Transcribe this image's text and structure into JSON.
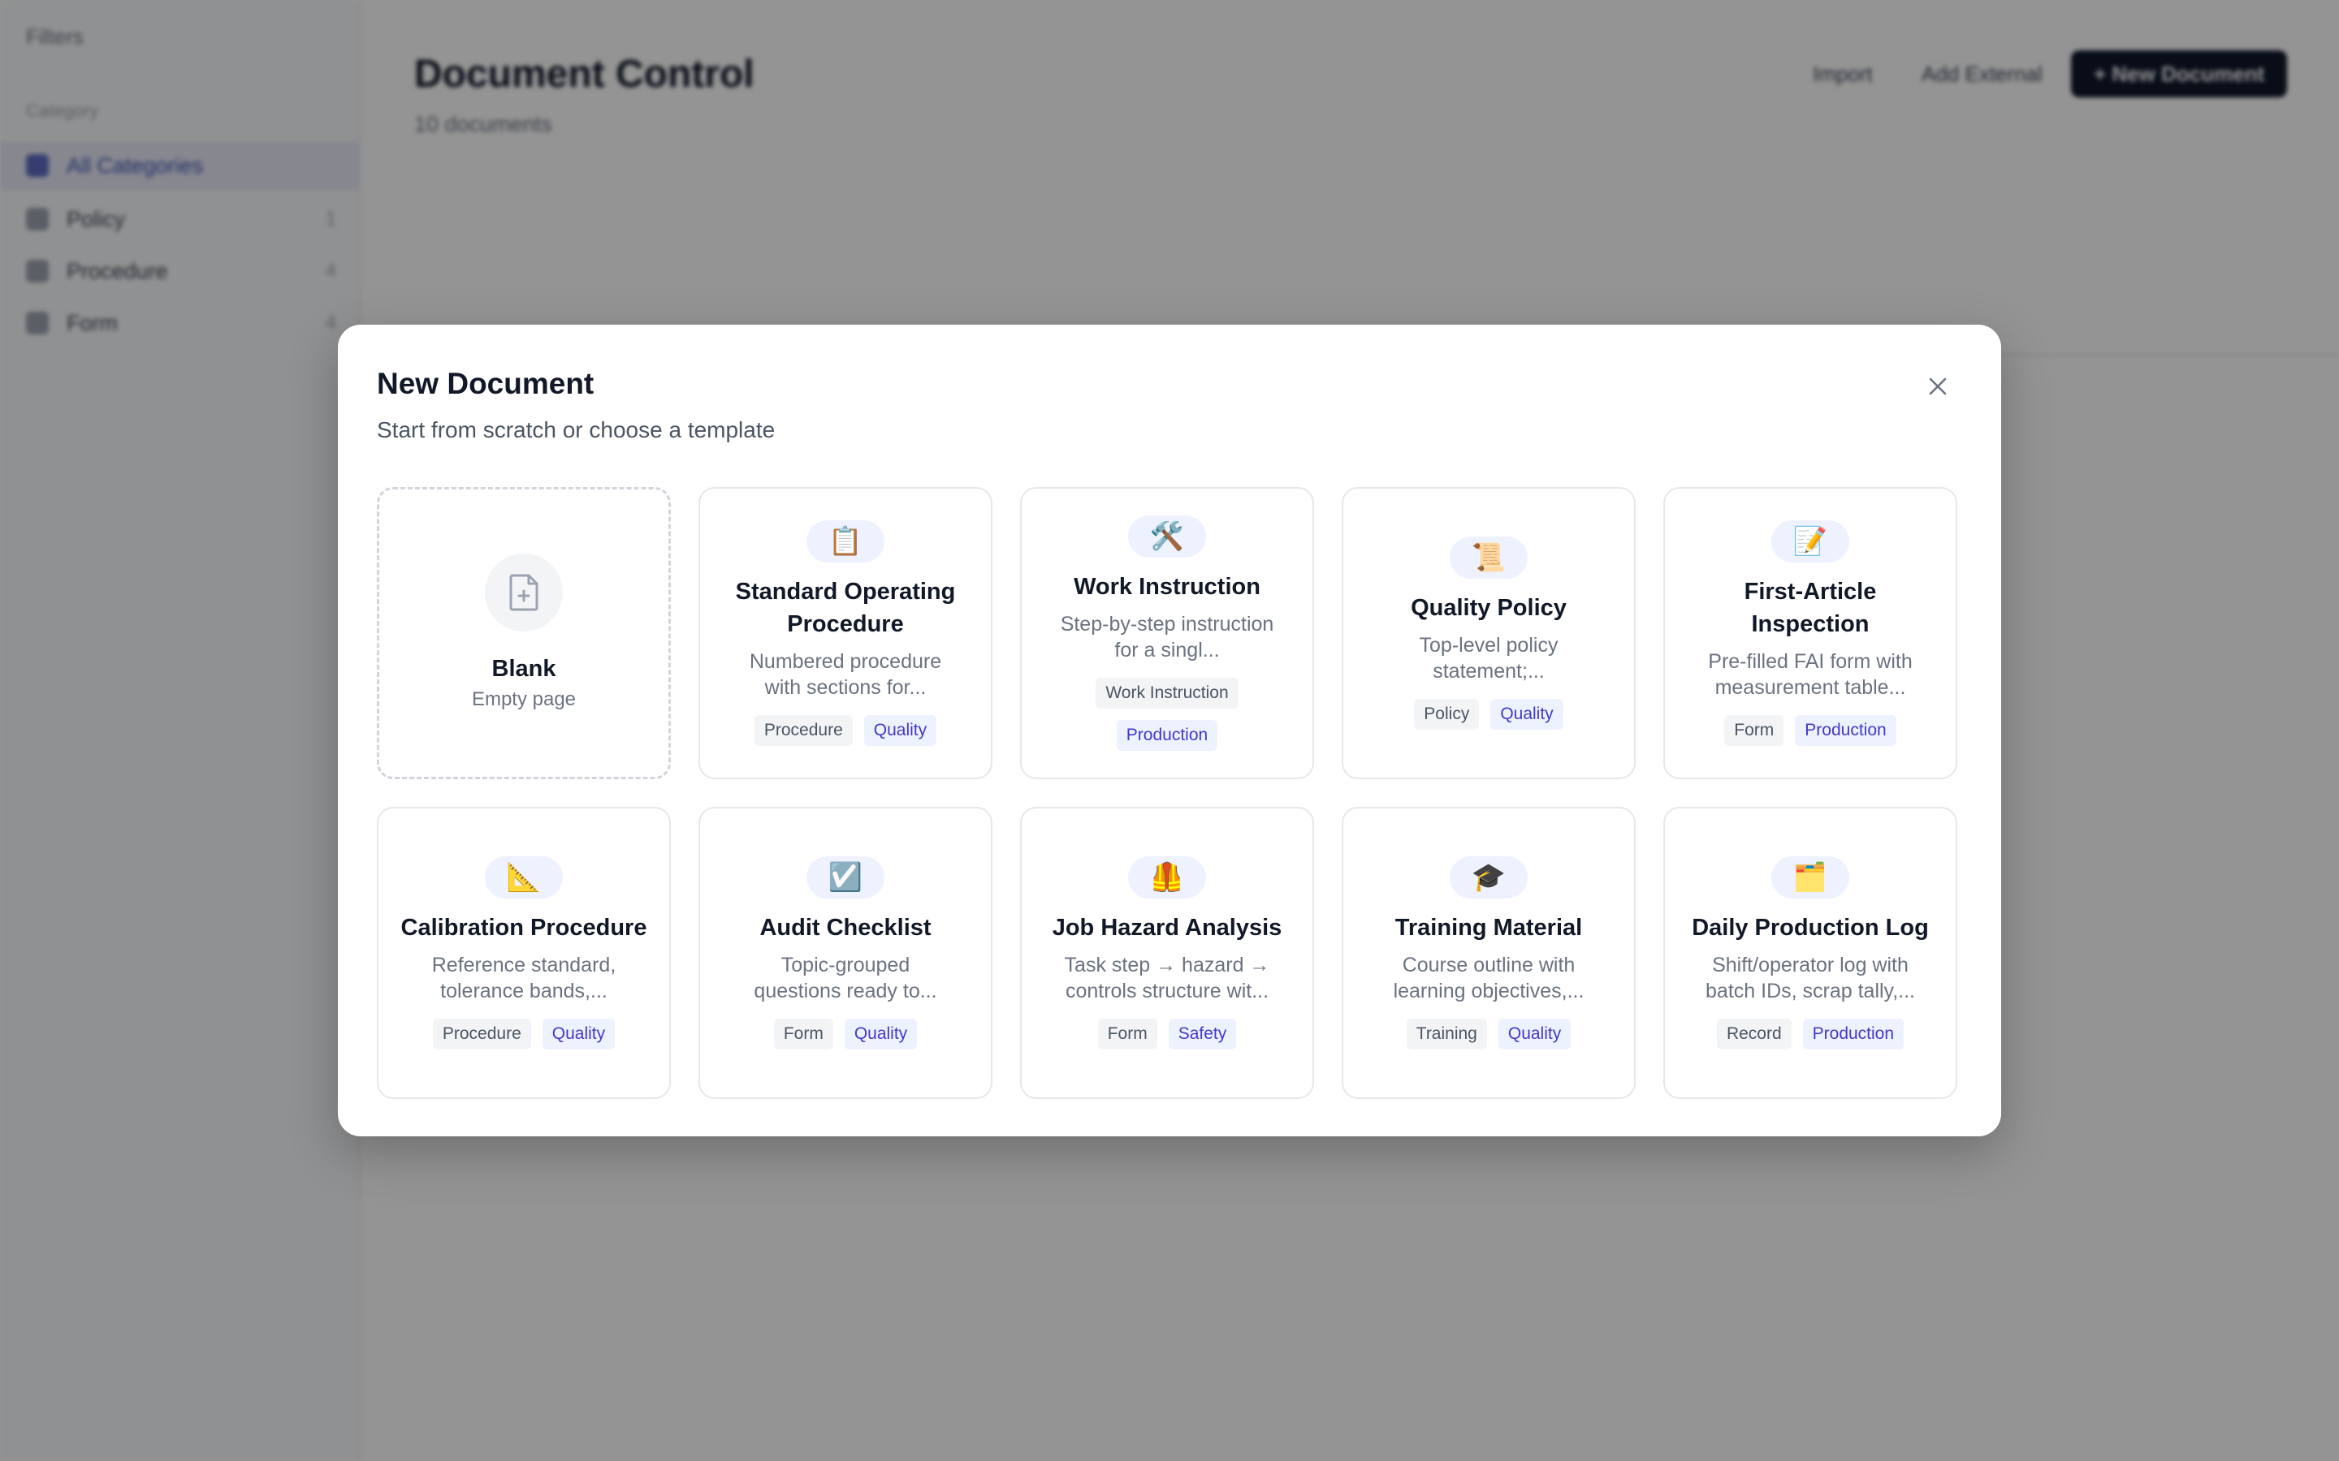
{
  "sidebar": {
    "filters_label": "Filters",
    "section_label": "Category",
    "items": [
      {
        "label": "All Categories",
        "count": ""
      },
      {
        "label": "Policy",
        "count": "1"
      },
      {
        "label": "Procedure",
        "count": "4"
      },
      {
        "label": "Form",
        "count": "4"
      }
    ]
  },
  "main": {
    "title": "Document Control",
    "subtitle": "10 documents",
    "import_label": "Import",
    "add_external_label": "Add External",
    "new_document_label": "+ New Document"
  },
  "modal": {
    "title": "New Document",
    "subtitle": "Start from scratch or choose a template",
    "close_icon": "close-icon",
    "blank": {
      "title": "Blank",
      "subtitle": "Empty page",
      "icon": "file-plus-icon"
    },
    "templates": [
      {
        "icon": "📋",
        "icon_name": "clipboard-icon",
        "title": "Standard Operating Procedure",
        "description": "Numbered procedure with sections for...",
        "type_tag": "Procedure",
        "dept_tag": "Quality"
      },
      {
        "icon": "🛠️",
        "icon_name": "tools-icon",
        "title": "Work Instruction",
        "description": "Step-by-step instruction for a singl...",
        "type_tag": "Work Instruction",
        "dept_tag": "Production"
      },
      {
        "icon": "📜",
        "icon_name": "scroll-icon",
        "title": "Quality Policy",
        "description": "Top-level policy statement;...",
        "type_tag": "Policy",
        "dept_tag": "Quality"
      },
      {
        "icon": "📝",
        "icon_name": "memo-icon",
        "title": "First-Article Inspection",
        "description": "Pre-filled FAI form with measurement table...",
        "type_tag": "Form",
        "dept_tag": "Production"
      },
      {
        "icon": "📐",
        "icon_name": "triangle-ruler-icon",
        "title": "Calibration Procedure",
        "description": "Reference standard, tolerance bands,...",
        "type_tag": "Procedure",
        "dept_tag": "Quality"
      },
      {
        "icon": "☑️",
        "icon_name": "checkbox-icon",
        "title": "Audit Checklist",
        "description": "Topic-grouped questions ready to...",
        "type_tag": "Form",
        "dept_tag": "Quality"
      },
      {
        "icon": "🦺",
        "icon_name": "safety-vest-icon",
        "title": "Job Hazard Analysis",
        "description": "Task step → hazard → controls structure wit...",
        "type_tag": "Form",
        "dept_tag": "Safety"
      },
      {
        "icon": "🎓",
        "icon_name": "graduation-cap-icon",
        "title": "Training Material",
        "description": "Course outline with learning objectives,...",
        "type_tag": "Training",
        "dept_tag": "Quality"
      },
      {
        "icon": "🗂️",
        "icon_name": "card-index-dividers-icon",
        "title": "Daily Production Log",
        "description": "Shift/operator log with batch IDs, scrap tally,...",
        "type_tag": "Record",
        "dept_tag": "Production"
      }
    ]
  }
}
